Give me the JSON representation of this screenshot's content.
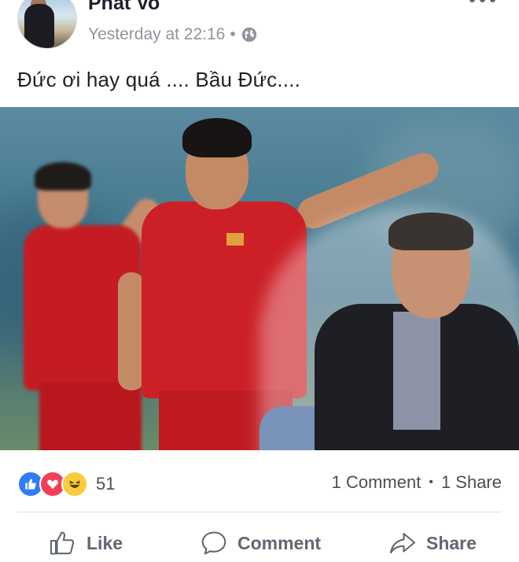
{
  "post": {
    "author": "Phat Vo",
    "timestamp": "Yesterday at 22:16",
    "separator": "•",
    "privacy_icon": "globe-icon",
    "text": "Đức ơi hay quá .... Bầu Đức....",
    "more_icon": "more-dots-icon"
  },
  "stats": {
    "reactions": [
      "like-icon",
      "love-icon",
      "haha-icon"
    ],
    "reaction_count": "51",
    "comments": "1 Comment",
    "bullet": "•",
    "shares": "1 Share"
  },
  "actions": {
    "like_label": "Like",
    "comment_label": "Comment",
    "share_label": "Share"
  },
  "colors": {
    "text": "#1d2129",
    "meta": "#90949c",
    "like_blue": "#2f7cf6",
    "love_red": "#f0405a",
    "haha_yellow": "#f8cd3d",
    "action_gray": "#606770"
  }
}
